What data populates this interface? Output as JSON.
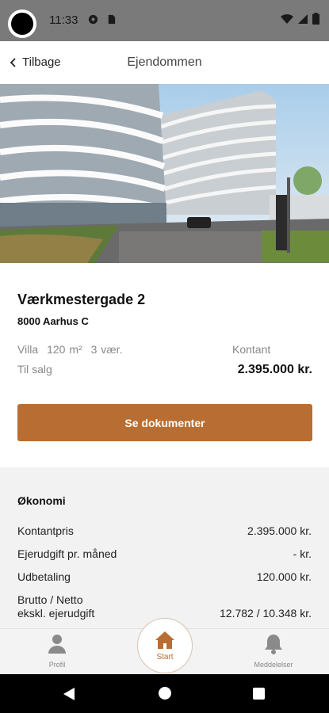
{
  "status_bar": {
    "time": "11:33"
  },
  "header": {
    "back_label": "Tilbage",
    "title": "Ejendommen"
  },
  "property": {
    "address": "Værkmestergade 2",
    "city": "8000 Aarhus C",
    "type": "Villa",
    "area": "120 m²",
    "rooms": "3 vær.",
    "sale_status": "Til salg",
    "price_label": "Kontant",
    "price": "2.395.000 kr."
  },
  "actions": {
    "documents_button": "Se dokumenter"
  },
  "economy": {
    "title": "Økonomi",
    "rows": [
      {
        "label": "Kontantpris",
        "value": "2.395.000 kr."
      },
      {
        "label": "Ejerudgift pr. måned",
        "value": "- kr."
      },
      {
        "label": "Udbetaling",
        "value": "120.000 kr."
      },
      {
        "label": "Brutto / Netto",
        "label2": "ekskl. ejerudgift",
        "value": "12.782 / 10.348 kr."
      }
    ]
  },
  "tabs": {
    "profile": "Profil",
    "home": "Start",
    "notifications": "Meddelelser"
  },
  "colors": {
    "accent": "#b86e33",
    "status_bar": "#7a7a7a",
    "economy_bg": "#f2f2f2"
  },
  "icons": [
    "back-chevron-icon",
    "person-icon",
    "home-icon",
    "bell-icon",
    "wifi-icon",
    "signal-icon",
    "battery-icon"
  ]
}
